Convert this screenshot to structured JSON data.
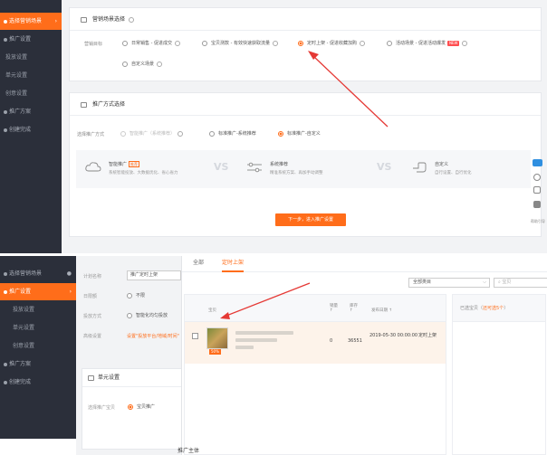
{
  "top": {
    "sidebar": [
      {
        "label": "选择营销场景",
        "active": true
      },
      {
        "label": "推广设置"
      },
      {
        "label": "投放设置"
      },
      {
        "label": "单元设置"
      },
      {
        "label": "创意设置"
      },
      {
        "label": "推广方案"
      },
      {
        "label": "创建完成"
      }
    ],
    "scene_card": {
      "title": "营销场景选择",
      "label": "营销目标",
      "options": [
        "日常销售 - 促进成交",
        "宝贝测款 - 有效快速获取流量",
        "定时上架 - 促进收藏加购",
        "活动场景 - 促进活动爆发",
        "自定义场景"
      ],
      "hot_badge": "NEW"
    },
    "method_card": {
      "title": "推广方式选择",
      "label": "选择推广方式",
      "options": [
        "智能推广（系统推荐）",
        "标准推广-系统推荐",
        "标准推广-自定义"
      ],
      "compare": [
        {
          "t1": "智能推广",
          "tag": "推荐",
          "t2": "系统智能投放、大数据优化、省心省力"
        },
        {
          "t1": "系统推荐",
          "t2": "精准系统方案、再加手动调整"
        },
        {
          "t1": "自定义",
          "t2": "自行设置、自行优化"
        }
      ],
      "vs": "VS"
    },
    "next_button": "下一步，进入推广设置",
    "right_tools": {
      "text": "帮助引导"
    }
  },
  "bottom": {
    "sidebar": [
      {
        "label": "选择营销场景"
      },
      {
        "label": "推广设置",
        "active": true
      },
      {
        "label": "投放设置"
      },
      {
        "label": "单元设置"
      },
      {
        "label": "创意设置"
      },
      {
        "label": "推广方案"
      },
      {
        "label": "创建完成"
      }
    ],
    "form": {
      "rows": [
        {
          "label": "计划名称",
          "value": "推广定时上架"
        },
        {
          "label": "日限额",
          "value": "不限"
        },
        {
          "label": "投放方式",
          "value": "智能化均匀投放"
        },
        {
          "label": "高级设置",
          "value": "设置\"投放平台/地域/时间\""
        }
      ],
      "unit_title": "单元设置",
      "unit_label": "选择推广宝贝",
      "unit_value": "宝贝推广"
    },
    "modal": {
      "tabs": [
        "全部",
        "定时上架"
      ],
      "category_select": "全部类目",
      "search_placeholder": "宝贝",
      "columns": {
        "item": "宝贝",
        "sales": "销量 ↑",
        "stock": "库存 ↑",
        "date": "发布日期 ↑"
      },
      "row": {
        "sales": "0",
        "stock": "36551",
        "date": "2019-05-30 00:00:00",
        "status": "定时上架",
        "badge": "50%"
      },
      "selected_header_prefix": "已选宝贝（",
      "selected_header_link": "还可选5个",
      "selected_header_suffix": "）"
    },
    "footer_text": "推广主体"
  },
  "colors": {
    "accent": "#ff6d1a",
    "sidebar": "#2b2f3a",
    "arrow": "#e53935"
  }
}
